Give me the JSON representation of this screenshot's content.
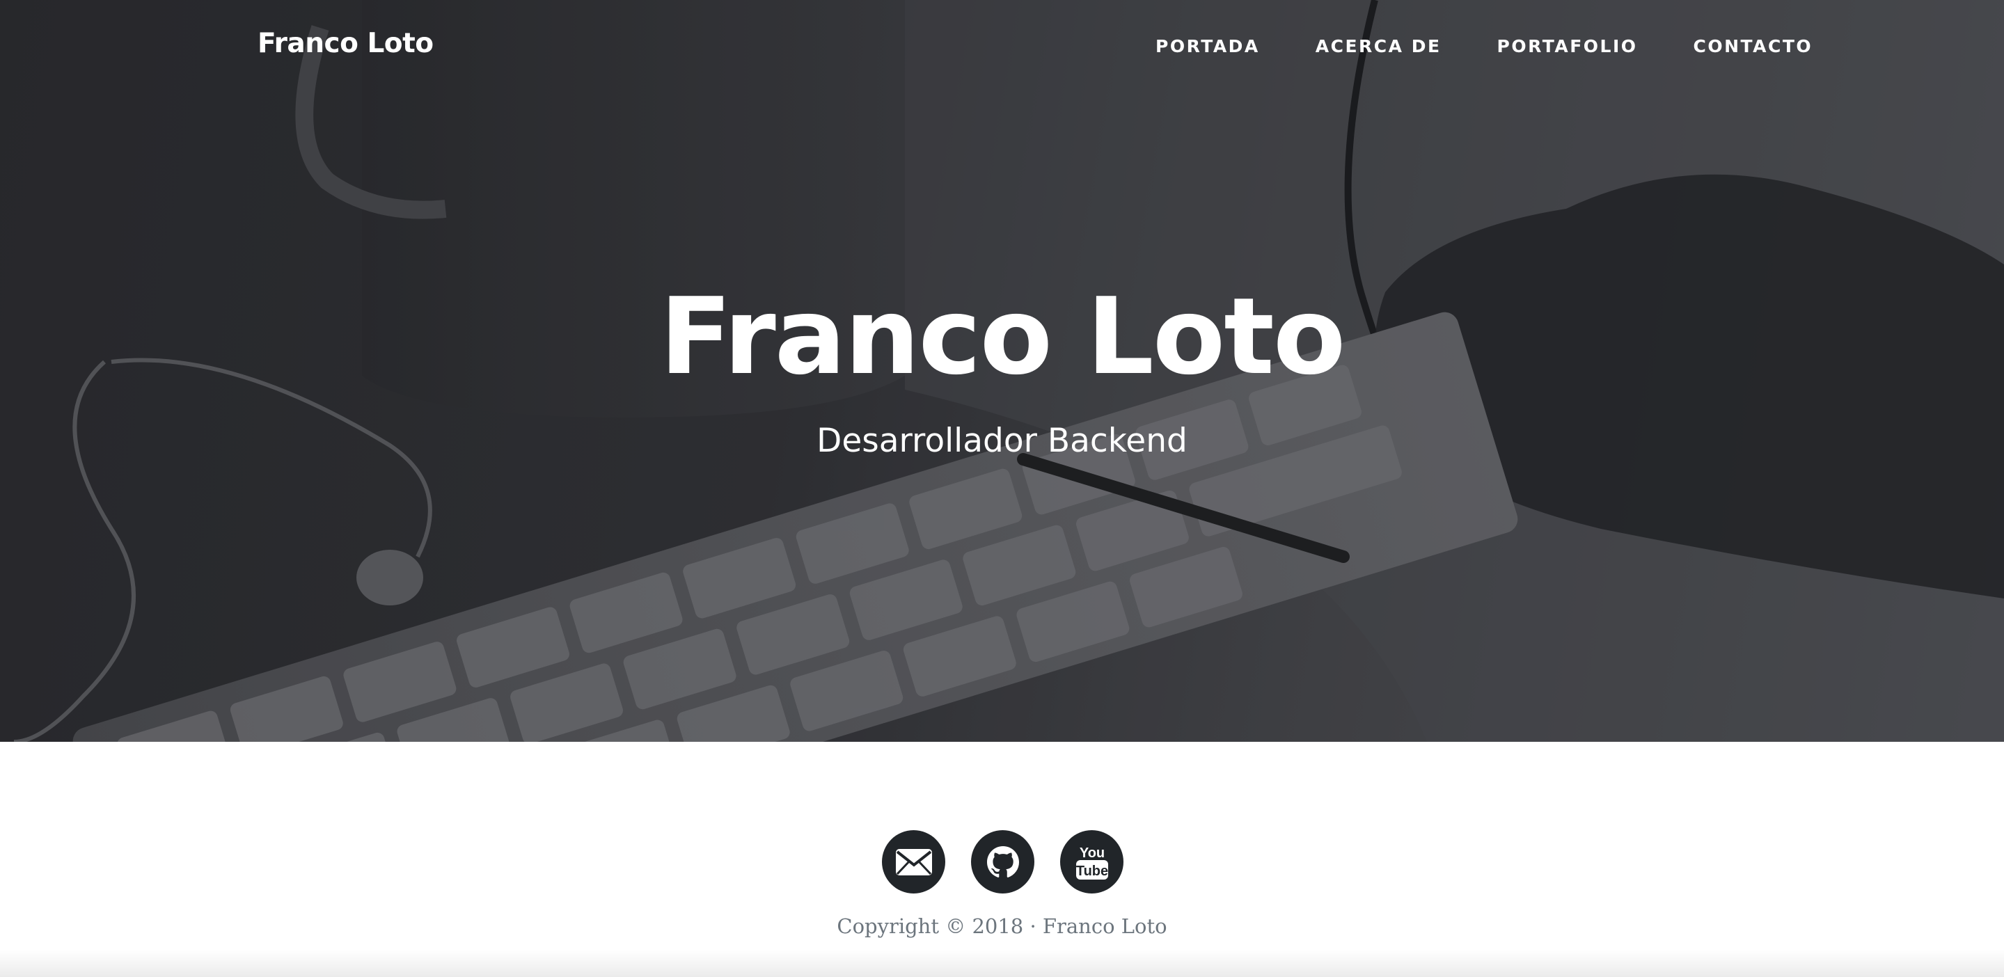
{
  "navbar": {
    "brand": "Franco Loto",
    "links": [
      {
        "label": "PORTADA"
      },
      {
        "label": "ACERCA DE"
      },
      {
        "label": "PORTAFOLIO"
      },
      {
        "label": "CONTACTO"
      }
    ]
  },
  "hero": {
    "title": "Franco Loto",
    "subtitle": "Desarrollador Backend"
  },
  "footer": {
    "social": [
      {
        "icon": "envelope-icon"
      },
      {
        "icon": "github-icon"
      },
      {
        "icon": "youtube-icon",
        "text_top": "You",
        "text_bottom": "Tube"
      }
    ],
    "copyright": "Copyright © 2018 · Franco Loto"
  },
  "colors": {
    "hero_dark": "#2b2c30",
    "hero_light": "#5a5b60",
    "social_bg": "#212529",
    "copyright_text": "#6c757d"
  }
}
